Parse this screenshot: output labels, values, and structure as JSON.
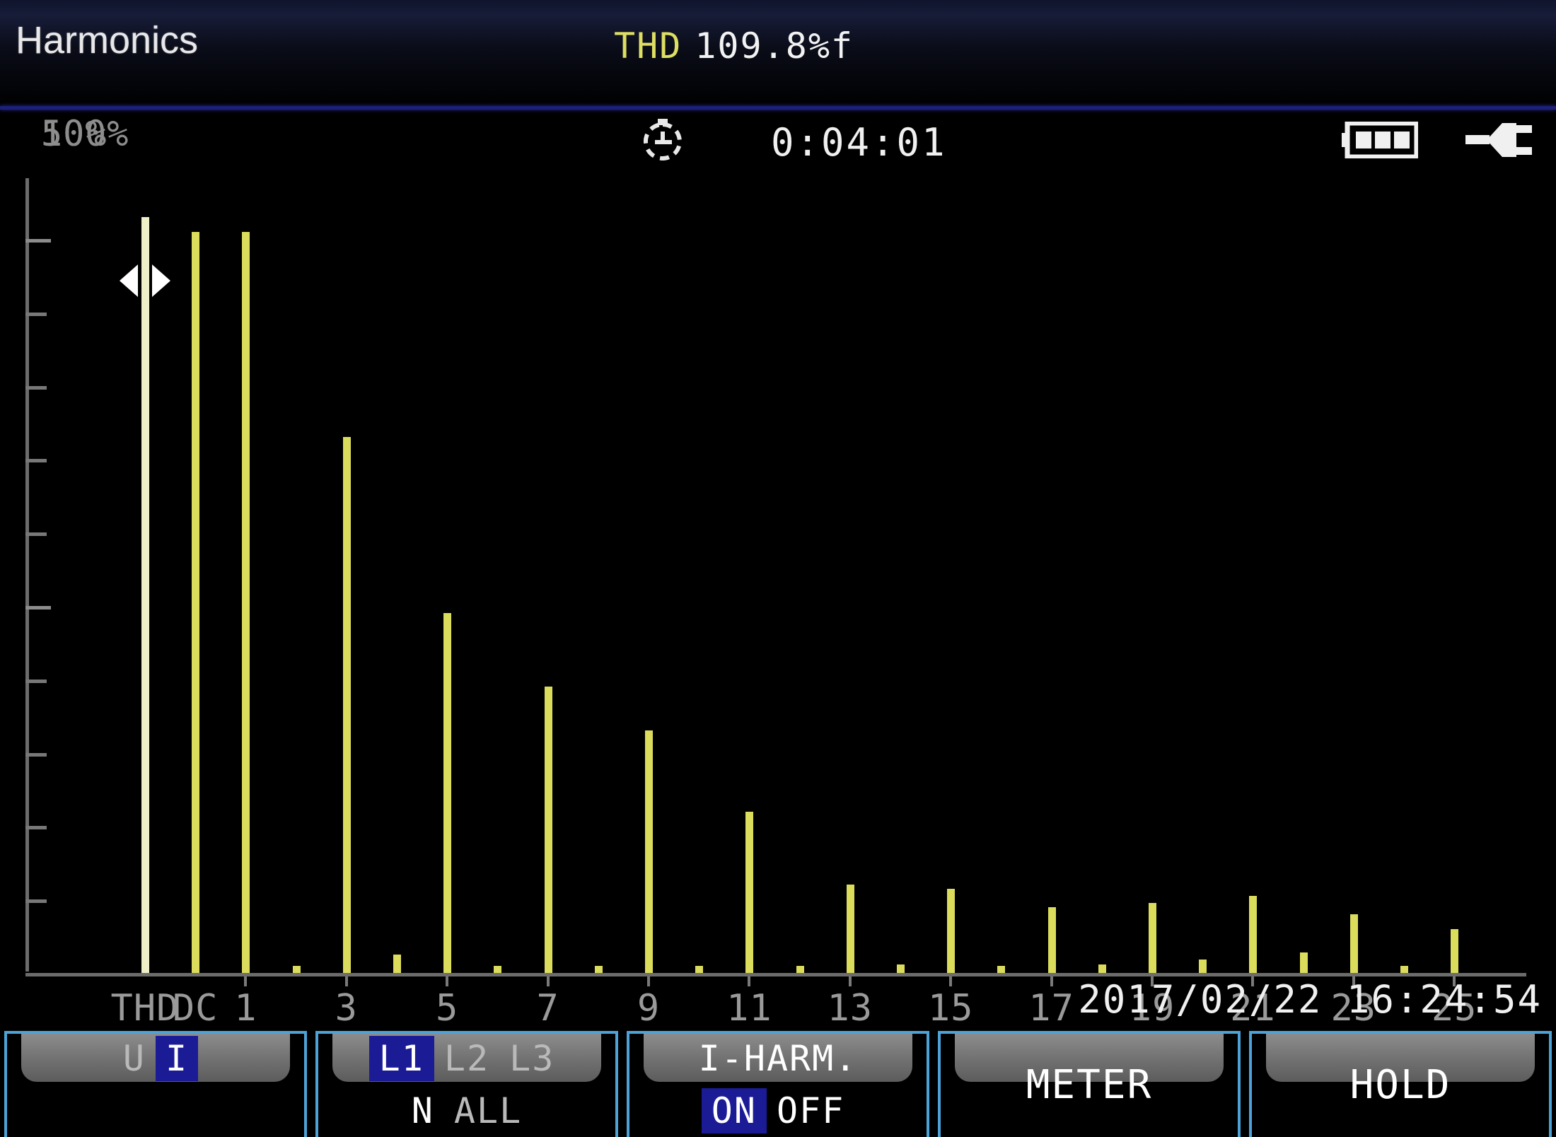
{
  "header": {
    "title": "Harmonics",
    "thd_label": "THD",
    "thd_value": "109.8%f"
  },
  "status": {
    "timer_icon": "stopwatch-icon",
    "timer": "0:04:01",
    "battery_icon": "battery-full-icon",
    "power_icon": "power-plug-icon"
  },
  "datetime": "2017/02/22  16:24:54",
  "chart_data": {
    "type": "bar",
    "title": "Harmonics",
    "xlabel": "",
    "ylabel": "%",
    "ylim": [
      0,
      110
    ],
    "grid": false,
    "legend": null,
    "y_ticks": [
      {
        "value": 100,
        "label": "100%"
      },
      {
        "value": 50,
        "label": "50%"
      }
    ],
    "y_minor_ticks": [
      90,
      80,
      70,
      60,
      40,
      30,
      20,
      10
    ],
    "categories": [
      "THD",
      "DC",
      "1",
      "2",
      "3",
      "4",
      "5",
      "6",
      "7",
      "8",
      "9",
      "10",
      "11",
      "12",
      "13",
      "14",
      "15",
      "16",
      "17",
      "18",
      "19",
      "20",
      "21",
      "22",
      "23",
      "24",
      "25"
    ],
    "tick_labels": [
      "THD",
      "DC",
      "1",
      "3",
      "5",
      "7",
      "9",
      "11",
      "13",
      "15",
      "17",
      "19",
      "21",
      "23",
      "25"
    ],
    "values": [
      103,
      101,
      101,
      1,
      73,
      2.5,
      49,
      1,
      39,
      1,
      33,
      1,
      22,
      1,
      12,
      1.2,
      11.5,
      1,
      9,
      1.2,
      9.5,
      1.8,
      10.5,
      2.8,
      8,
      1,
      6
    ],
    "cursor_index": 0,
    "cursor_category": "THD",
    "bar_color": "#dcdc5c",
    "cursor_bar_color": "#eff0c8",
    "axis_color": "#6c6c6c"
  },
  "softkeys": [
    {
      "name": "quantity",
      "top": [
        {
          "label": "U",
          "state": "off"
        },
        {
          "label": "I",
          "state": "on"
        }
      ],
      "bottom": []
    },
    {
      "name": "phase",
      "top": [
        {
          "label": "L1",
          "state": "on"
        },
        {
          "label": "L2",
          "state": "off"
        },
        {
          "label": "L3",
          "state": "off"
        }
      ],
      "bottom": [
        {
          "label": "N",
          "state": "lit"
        },
        {
          "label": "ALL",
          "state": "off"
        }
      ]
    },
    {
      "name": "i-harm",
      "top": [
        {
          "label": "I-HARM.",
          "state": "lit"
        }
      ],
      "bottom": [
        {
          "label": "ON",
          "state": "on"
        },
        {
          "label": "OFF",
          "state": "lit"
        }
      ]
    },
    {
      "name": "meter",
      "single": "METER"
    },
    {
      "name": "hold",
      "single": "HOLD"
    }
  ]
}
